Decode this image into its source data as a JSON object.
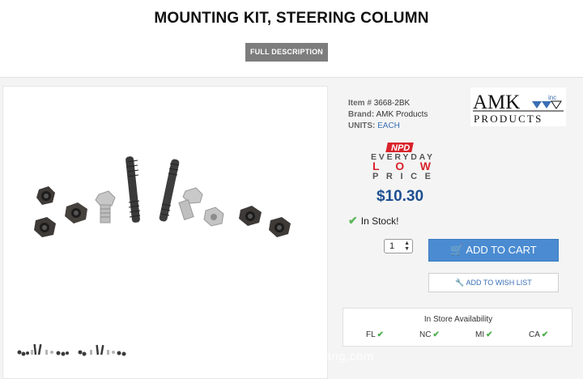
{
  "title": "MOUNTING KIT, STEERING COLUMN",
  "full_description_label": "FULL DESCRIPTION",
  "item": {
    "label": "Item #",
    "value": "3668-2BK"
  },
  "brand": {
    "label": "Brand:",
    "value": "AMK Products"
  },
  "units": {
    "label": "UNITS:",
    "value": "EACH"
  },
  "brand_logo_text": {
    "line1": "AMK",
    "line2": "PRODUCTS",
    "suffix": "inc"
  },
  "badge": {
    "line1": "NPD",
    "line2": "EVERYDAY",
    "line3": "LOW",
    "line4": "PRICE"
  },
  "price": "$10.30",
  "stock_status": "In Stock!",
  "quantity": "1",
  "add_to_cart_label": "ADD TO CART",
  "add_to_wishlist_label": "ADD TO WISH LIST",
  "availability": {
    "title": "In Store Availability",
    "stores": [
      "FL",
      "NC",
      "MI",
      "CA"
    ]
  },
  "watermark": "stang.com",
  "colors": {
    "primary_button": "#4a8bd1",
    "price": "#1d4f91",
    "in_stock": "#5cb85c",
    "badge_red": "#d9232b"
  }
}
